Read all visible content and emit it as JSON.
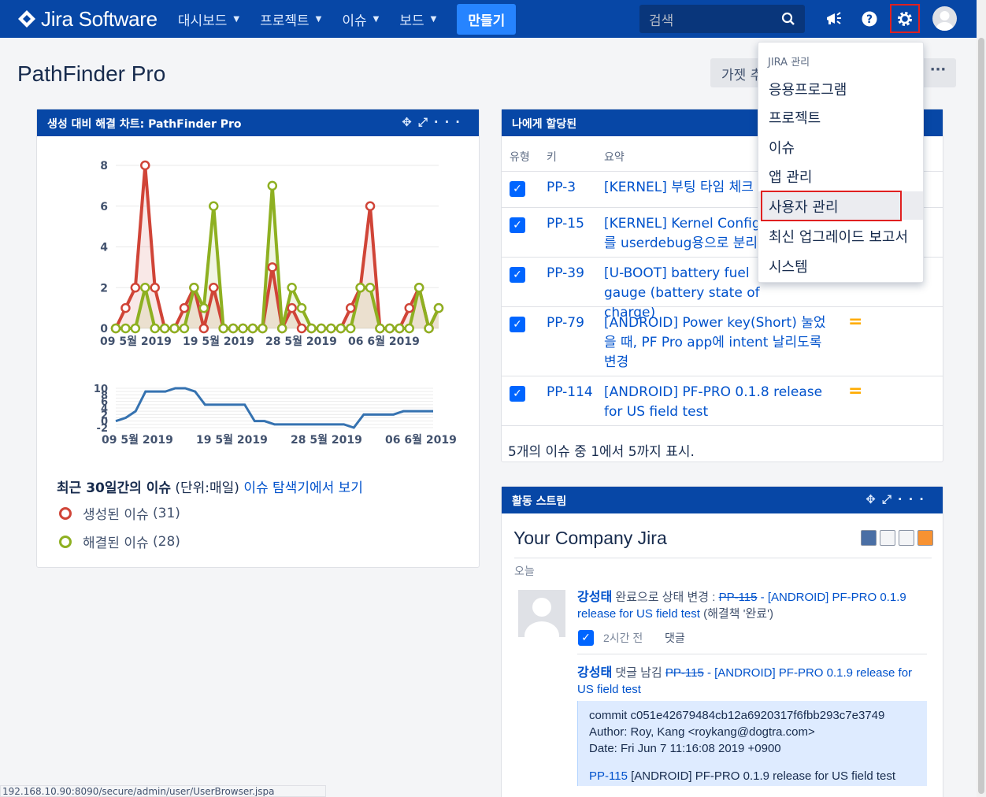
{
  "nav": {
    "logo_text": "Jira Software",
    "items": [
      {
        "label": "대시보드"
      },
      {
        "label": "프로젝트"
      },
      {
        "label": "이슈"
      },
      {
        "label": "보드"
      }
    ],
    "create_label": "만들기",
    "search_placeholder": "검색"
  },
  "page": {
    "title": "PathFinder Pro",
    "gadget_button": "가젯 추가",
    "more_button": "···"
  },
  "chart_gadget": {
    "title": "생성 대비 해결 차트: PathFinder Pro",
    "legend_prefix": "최근 30일간의 이슈",
    "legend_unit": " (단위:매일) ",
    "legend_link": "이슈 탐색기에서 보기",
    "created_label": "생성된 이슈",
    "created_count": "(31)",
    "resolved_label": "해결된 이슈",
    "resolved_count": "(28)"
  },
  "chart_data": [
    {
      "type": "line",
      "x": [
        "09 5월 2019",
        "19 5월 2019",
        "28 5월 2019",
        "06 6월 2019"
      ],
      "ylim": [
        0,
        8
      ],
      "yticks": [
        "0",
        "2",
        "4",
        "6",
        "8"
      ],
      "series": [
        {
          "name": "생성된 이슈",
          "color": "#d04437",
          "values": [
            0,
            1,
            2,
            8,
            2,
            0,
            0,
            1,
            2,
            0,
            2,
            0,
            0,
            0,
            0,
            0,
            3,
            0,
            1,
            0,
            0,
            0,
            0,
            0,
            1,
            2,
            6,
            0,
            0,
            0,
            1,
            2,
            0,
            1
          ]
        },
        {
          "name": "해결된 이슈",
          "color": "#8eb021",
          "values": [
            0,
            0,
            0,
            2,
            0,
            0,
            0,
            0,
            2,
            1,
            6,
            0,
            0,
            0,
            0,
            0,
            7,
            0,
            2,
            1,
            0,
            0,
            0,
            0,
            0,
            2,
            2,
            0,
            0,
            0,
            0,
            2,
            0,
            1
          ]
        }
      ]
    },
    {
      "type": "line",
      "x": [
        "09 5월 2019",
        "19 5월 2019",
        "28 5월 2019",
        "06 6월 2019"
      ],
      "ylim": [
        -2,
        10
      ],
      "yticks": [
        "10",
        "8",
        "6",
        "4",
        "2",
        "0",
        "-2"
      ],
      "series": [
        {
          "color": "#3572b0",
          "values": [
            0,
            1,
            3,
            9,
            9,
            9,
            10,
            10,
            9,
            5,
            5,
            5,
            5,
            5,
            0,
            0,
            -1,
            -1,
            -1,
            -1,
            -1,
            -1,
            -1,
            -1,
            -2,
            2,
            2,
            2,
            2,
            3,
            3,
            3,
            3
          ]
        }
      ]
    }
  ],
  "assigned_gadget": {
    "title": "나에게 할당된",
    "col_type": "유형",
    "col_key": "키",
    "col_summary": "요약",
    "rows": [
      {
        "key": "PP-3",
        "summary": "[KERNEL] 부팅 타임 체크",
        "priority": ""
      },
      {
        "key": "PP-15",
        "summary": "[KERNEL] Kernel Config를 userdebug용으로 분리",
        "priority": ""
      },
      {
        "key": "PP-39",
        "summary": "[U-BOOT] battery fuel gauge (battery state of charge)",
        "priority": ""
      },
      {
        "key": "PP-79",
        "summary": "[ANDROID] Power key(Short) 눌었을 때, PF Pro app에 intent 날리도록 변경",
        "priority": "="
      },
      {
        "key": "PP-114",
        "summary": "[ANDROID] PF-PRO 0.1.8 release for US field test",
        "priority": "="
      }
    ],
    "footer": "5개의 이슈 중 1에서 5까지 표시."
  },
  "activity_gadget": {
    "title": "활동 스트림",
    "heading": "Your Company Jira",
    "day_label": "오늘",
    "entry1": {
      "user": "강성태",
      "action": " 완료으로 상태 변경 : ",
      "issue_key": "PP-115",
      "issue_title": " - [ANDROID] PF-PRO 0.1.9 release for US field test",
      "resolution": " (해결책 '완료')",
      "time": "2시간 전",
      "comment_link": "댓글"
    },
    "entry2": {
      "user": "강성태",
      "action": " 댓글 남김 ",
      "issue_key": "PP-115",
      "issue_title": " - [ANDROID] PF-PRO 0.1.9 release for US field test",
      "commit_line1": "commit c051e42679484cb12a6920317f6fbb293c7e3749",
      "commit_line2": "Author: Roy, Kang <roykang@dogtra.com>",
      "commit_line3": "Date: Fri Jun 7 11:16:08 2019 +0900",
      "commit_link": "PP-115",
      "commit_text": " [ANDROID] PF-PRO 0.1.9 release for US field test"
    }
  },
  "admin_menu": {
    "heading": "JIRA 관리",
    "items": [
      "응용프로그램",
      "프로젝트",
      "이슈",
      "앱 관리",
      "사용자 관리",
      "최신 업그레이드 보고서",
      "시스템"
    ]
  },
  "status_url": "192.168.10.90:8090/secure/admin/user/UserBrowser.jspa"
}
